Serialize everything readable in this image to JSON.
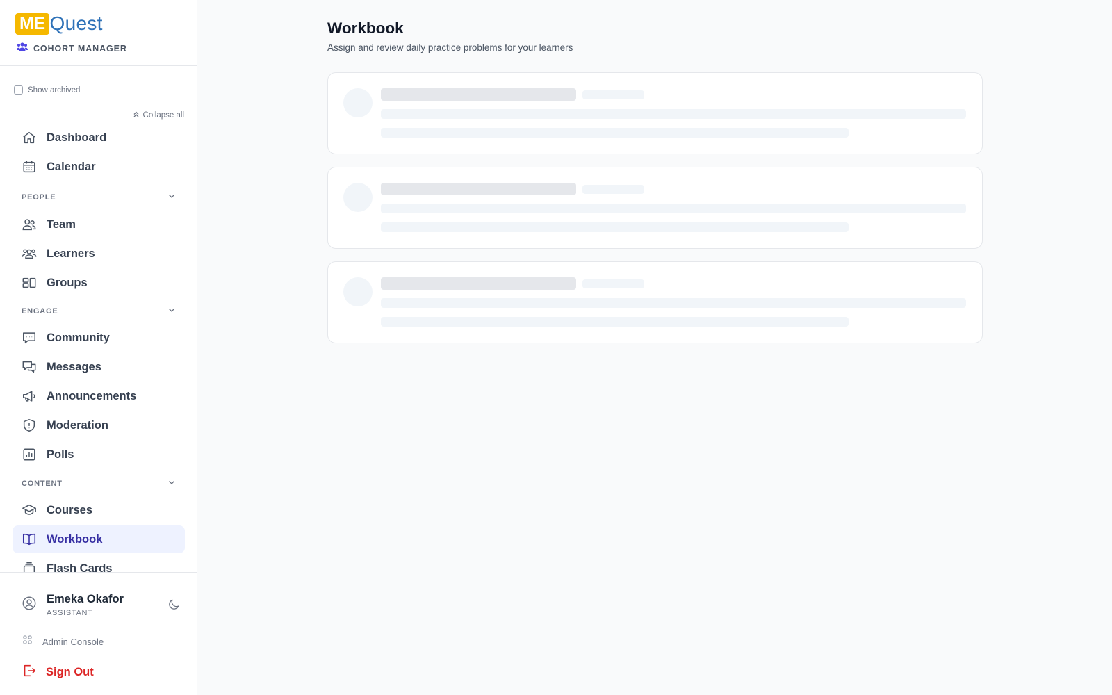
{
  "brand": {
    "logo_me": "ME",
    "logo_quest": "Quest",
    "subtitle": "COHORT MANAGER",
    "colors": {
      "me_bg": "#f5b800",
      "quest": "#2f72b8"
    }
  },
  "sidebar": {
    "show_archived_label": "Show archived",
    "show_archived_checked": false,
    "collapse_all_label": "Collapse all",
    "top_items": [
      {
        "label": "Dashboard",
        "icon": "home-icon"
      },
      {
        "label": "Calendar",
        "icon": "calendar-icon"
      }
    ],
    "sections": [
      {
        "title": "PEOPLE",
        "items": [
          {
            "label": "Team",
            "icon": "team-icon"
          },
          {
            "label": "Learners",
            "icon": "learners-icon"
          },
          {
            "label": "Groups",
            "icon": "groups-icon"
          }
        ]
      },
      {
        "title": "ENGAGE",
        "items": [
          {
            "label": "Community",
            "icon": "chat-bubble-icon"
          },
          {
            "label": "Messages",
            "icon": "messages-icon"
          },
          {
            "label": "Announcements",
            "icon": "megaphone-icon"
          },
          {
            "label": "Moderation",
            "icon": "shield-icon"
          },
          {
            "label": "Polls",
            "icon": "bar-chart-icon"
          }
        ]
      },
      {
        "title": "CONTENT",
        "items": [
          {
            "label": "Courses",
            "icon": "graduation-cap-icon"
          },
          {
            "label": "Workbook",
            "icon": "book-icon",
            "active": true
          },
          {
            "label": "Flash Cards",
            "icon": "cards-icon"
          }
        ]
      }
    ],
    "active_color": "#3730a3",
    "active_bg": "#eef2ff"
  },
  "footer": {
    "user_name": "Emeka Okafor",
    "user_role": "ASSISTANT",
    "admin_console_label": "Admin Console",
    "sign_out_label": "Sign Out",
    "sign_out_color": "#dc2626"
  },
  "main": {
    "title": "Workbook",
    "subtitle": "Assign and review daily practice problems for your learners",
    "loading_cards": 3
  }
}
